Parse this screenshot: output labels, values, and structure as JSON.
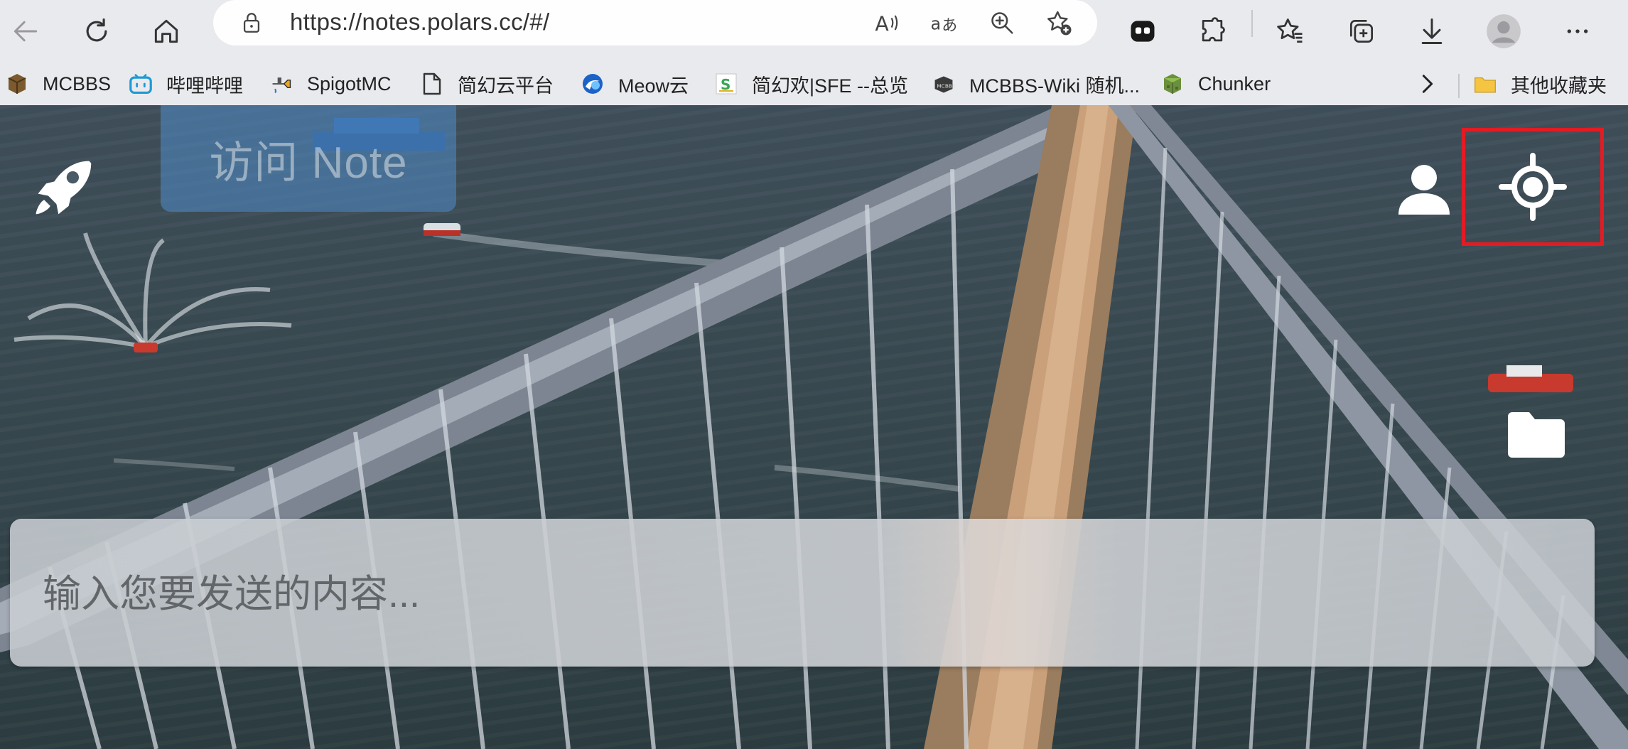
{
  "browser": {
    "url": "https://notes.polars.cc/#/",
    "buttons": {
      "back": "back-icon",
      "refresh": "refresh-icon",
      "home": "home-icon",
      "read_aloud": "read-aloud-icon",
      "translate": "translate-icon",
      "zoom": "zoom-icon",
      "add_favorite": "add-favorite-icon",
      "extension": "extension-icon",
      "extensions": "puzzle-icon",
      "favorites": "favorites-icon",
      "collections": "collections-icon",
      "downloads": "download-icon",
      "profile": "profile-icon",
      "more": "more-icon"
    }
  },
  "bookmarks": {
    "items": [
      {
        "label": "MCBBS",
        "icon": "mcbbs-icon"
      },
      {
        "label": "哔哩哔哩",
        "icon": "bilibili-icon"
      },
      {
        "label": "SpigotMC",
        "icon": "spigot-icon"
      },
      {
        "label": "简幻云平台",
        "icon": "page-icon"
      },
      {
        "label": "Meow云",
        "icon": "meow-icon"
      },
      {
        "label": "简幻欢|SFE --总览",
        "icon": "sfe-icon"
      },
      {
        "label": "MCBBS-Wiki 随机...",
        "icon": "mcbbs-wiki-icon"
      },
      {
        "label": "Chunker",
        "icon": "chunker-icon"
      }
    ],
    "overflow_icon": "chevron-right-icon",
    "other_folder": {
      "label": "其他收藏夹",
      "icon": "folder-icon"
    }
  },
  "page": {
    "visit_button": "访问 Note",
    "compose_placeholder": "输入您要发送的内容...",
    "icons": {
      "rocket": "rocket-icon",
      "user": "user-icon",
      "locate": "crosshair-icon",
      "folder": "folder-icon"
    },
    "highlight_color": "#e31b23"
  }
}
